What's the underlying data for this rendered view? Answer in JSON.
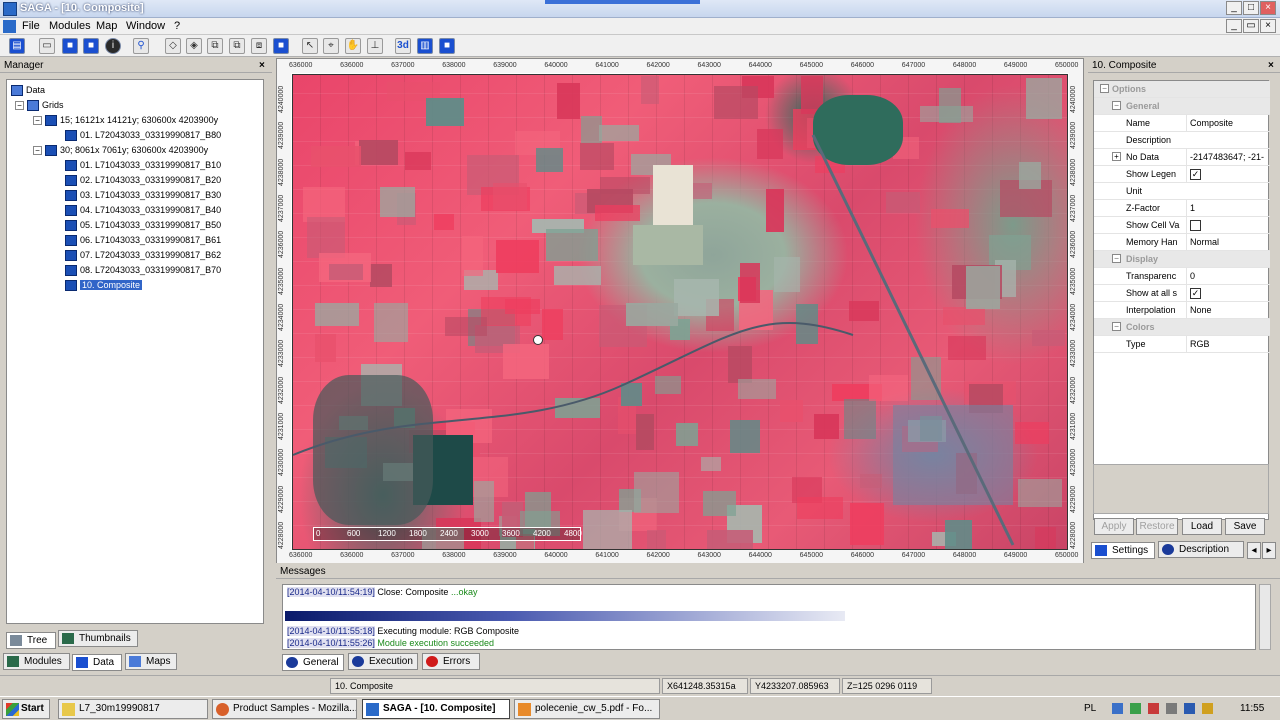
{
  "window": {
    "title": "SAGA - [10. Composite]"
  },
  "menu": [
    "File",
    "Modules",
    "Map",
    "Window",
    "?"
  ],
  "manager": {
    "title": "Manager",
    "root": "Data",
    "grids_label": "Grids",
    "system1": "15; 16121x 14121y; 630600x 4203900y",
    "system1_items": [
      "01. L72043033_03319990817_B80"
    ],
    "system2": "30; 8061x 7061y; 630600x 4203900y",
    "system2_items": [
      "01. L71043033_03319990817_B10",
      "02. L71043033_03319990817_B20",
      "03. L71043033_03319990817_B30",
      "04. L71043033_03319990817_B40",
      "05. L71043033_03319990817_B50",
      "06. L71043033_03319990817_B61",
      "07. L72043033_03319990817_B62",
      "08. L72043033_03319990817_B70"
    ],
    "selected_item": "10. Composite",
    "tabs_top": [
      "Tree",
      "Thumbnails"
    ],
    "tabs_bottom": [
      "Modules",
      "Data",
      "Maps"
    ]
  },
  "map": {
    "top_ticks": [
      "636000",
      "636000",
      "637000",
      "638000",
      "639000",
      "640000",
      "641000",
      "642000",
      "643000",
      "644000",
      "645000",
      "646000",
      "647000",
      "648000",
      "649000",
      "650000"
    ],
    "bottom_ticks": [
      "636000",
      "636000",
      "637000",
      "638000",
      "639000",
      "640000",
      "641000",
      "642000",
      "643000",
      "644000",
      "645000",
      "646000",
      "647000",
      "648000",
      "649000",
      "650000"
    ],
    "left_ticks": [
      "4240000",
      "4239000",
      "4238000",
      "4237000",
      "4236000",
      "4235000",
      "4234000",
      "4233000",
      "4232000",
      "4231000",
      "4230000",
      "4229000",
      "4228000"
    ],
    "scale_labels": [
      "0",
      "600",
      "1200",
      "1800",
      "2400",
      "3000",
      "3600",
      "4200",
      "4800"
    ]
  },
  "props": {
    "title": "10. Composite",
    "cat_options": "Options",
    "cat_general": "General",
    "name_k": "Name",
    "name_v": "Composite",
    "desc_k": "Description",
    "desc_v": "",
    "nodata_k": "No Data",
    "nodata_v": "-2147483647; -21-",
    "legend_k": "Show Legen",
    "unit_k": "Unit",
    "unit_v": "",
    "zfactor_k": "Z-Factor",
    "zfactor_v": "1",
    "cellval_k": "Show Cell Va",
    "memory_k": "Memory Han",
    "memory_v": "Normal",
    "cat_display": "Display",
    "transp_k": "Transparenc",
    "transp_v": "0",
    "showall_k": "Show at all s",
    "interp_k": "Interpolation",
    "interp_v": "None",
    "cat_colors": "Colors",
    "type_k": "Type",
    "type_v": "RGB",
    "btn_apply": "Apply",
    "btn_restore": "Restore",
    "btn_load": "Load",
    "btn_save": "Save",
    "tab_settings": "Settings",
    "tab_description": "Description"
  },
  "messages": {
    "title": "Messages",
    "l1_ts": "[2014-04-10/11:54:19]",
    "l1_text": " Close: Composite",
    "l1_ok": " ...okay",
    "l2_ts": "[2014-04-10/11:55:18]",
    "l2_text": " Executing module: RGB Composite",
    "l3_ts": "[2014-04-10/11:55:26]",
    "l3_ok": " Module execution succeeded",
    "tabs": [
      "General",
      "Execution",
      "Errors"
    ]
  },
  "status": {
    "name": "10. Composite",
    "x": "X641248.35315a",
    "y": "Y4233207.085963",
    "z": "Z=125 0296 0119"
  },
  "taskbar": {
    "start": "Start",
    "items": [
      "L7_30m19990817",
      "Product Samples - Mozilla...",
      "SAGA - [10. Composite]",
      "polecenie_cw_5.pdf - Fo..."
    ],
    "lang": "PL",
    "clock": "11:55"
  },
  "colors": {
    "accent": "#1a4fd0",
    "selection": "#3165c8",
    "field_red": "#e8455f",
    "vegetation_gray": "#8fa59a"
  }
}
